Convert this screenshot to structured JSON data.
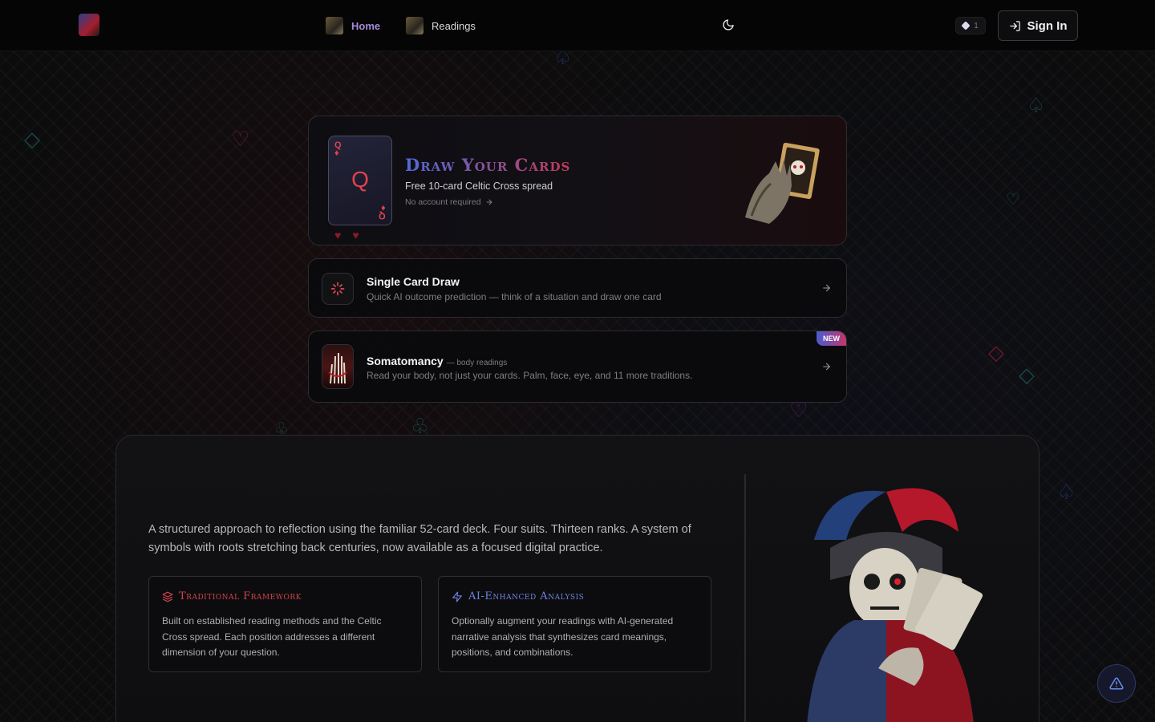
{
  "nav": {
    "links": [
      {
        "label": "Home",
        "active": true
      },
      {
        "label": "Readings",
        "active": false
      }
    ],
    "credits": "1",
    "signin_label": "Sign In"
  },
  "hero": {
    "card_rank": "Q",
    "title": "Draw Your Cards",
    "subtitle": "Free 10-card Celtic Cross spread",
    "note": "No account required"
  },
  "options": {
    "single": {
      "title": "Single Card Draw",
      "description": "Quick AI outcome prediction — think of a situation and draw one card"
    },
    "soma": {
      "title": "Somatomancy",
      "tag": "— body readings",
      "description": "Read your body, not just your cards. Palm, face, eye, and 11 more traditions.",
      "badge": "NEW"
    }
  },
  "panel": {
    "intro": "A structured approach to reflection using the familiar 52-card deck. Four suits. Thirteen ranks. A system of symbols with roots stretching back centuries, now available as a focused digital practice.",
    "features": [
      {
        "title": "Traditional Framework",
        "body": "Built on established reading methods and the Celtic Cross spread. Each position addresses a different dimension of your question."
      },
      {
        "title": "AI-Enhanced Analysis",
        "body": "Optionally augment your readings with AI-generated narrative analysis that synthesizes card meanings, positions, and combinations."
      }
    ]
  },
  "colors": {
    "accent_red": "#d0434e",
    "accent_blue": "#6f83e0",
    "active_nav": "#a58bd8"
  }
}
